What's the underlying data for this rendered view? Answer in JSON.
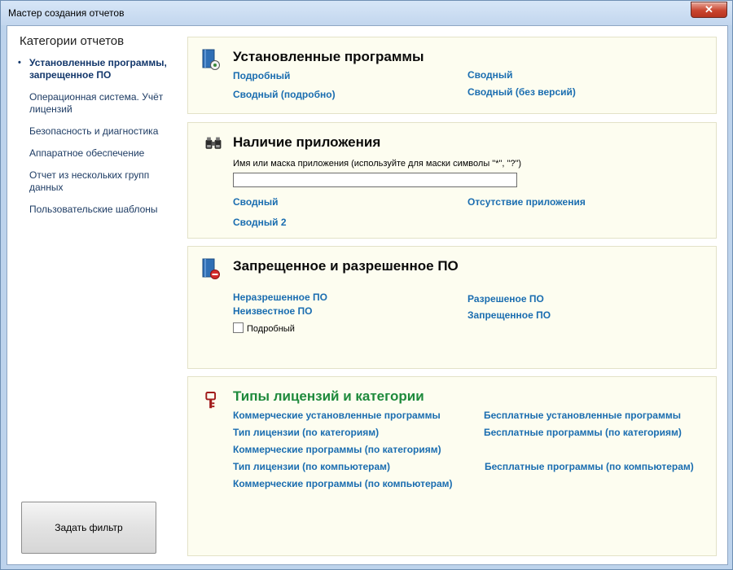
{
  "window": {
    "title": "Мастер создания отчетов",
    "close_glyph": "✕"
  },
  "sidebar": {
    "heading": "Категории отчетов",
    "items": [
      {
        "label": "Установленные программы, запрещенное ПО",
        "active": true
      },
      {
        "label": "Операционная система. Учёт лицензий",
        "active": false
      },
      {
        "label": "Безопасность и диагностика",
        "active": false
      },
      {
        "label": "Аппаратное обеспечение",
        "active": false
      },
      {
        "label": "Отчет из нескольких групп данных",
        "active": false
      },
      {
        "label": "Пользовательские шаблоны",
        "active": false
      }
    ],
    "bullet": "•",
    "filter_button": "Задать фильтр"
  },
  "panels": {
    "installed": {
      "title": "Установленные программы",
      "links": [
        "Подробный",
        "Сводный (подробно)",
        "Сводный",
        "Сводный (без версий)"
      ]
    },
    "app_presence": {
      "title": "Наличие приложения",
      "field_label": "Имя или маска приложения (используйте для маски символы \"*\", \"?\")",
      "field_value": "",
      "links": [
        "Сводный",
        "Сводный 2",
        "Отсутствие приложения"
      ]
    },
    "prohibited": {
      "title": "Запрещенное и разрешенное ПО",
      "links": [
        "Неразрешенное ПО",
        "Неизвестное ПО",
        "Разрешеное ПО",
        "Запрещенное ПО"
      ],
      "checkbox_label": "Подробный",
      "checkbox_checked": false
    },
    "licenses": {
      "title": "Типы лицензий и категории",
      "links": [
        "Коммерческие установленные программы",
        "Тип лицензии (по категориям)",
        "Коммерческие программы (по категориям)",
        "Тип лицензии (по компьютерам)",
        "Коммерческие программы (по компьютерам)",
        "Бесплатные установленные программы",
        "Бесплатные программы (по категориям)",
        "Бесплатные программы (по компьютерам)"
      ]
    }
  },
  "colors": {
    "link": "#1a6db0",
    "green_title": "#1e8a3c",
    "panel_bg": "#fdfdf0",
    "key_icon": "#a11a1a"
  },
  "icons": [
    "book-add-icon",
    "binoculars-icon",
    "book-prohibited-icon",
    "key-icon"
  ]
}
